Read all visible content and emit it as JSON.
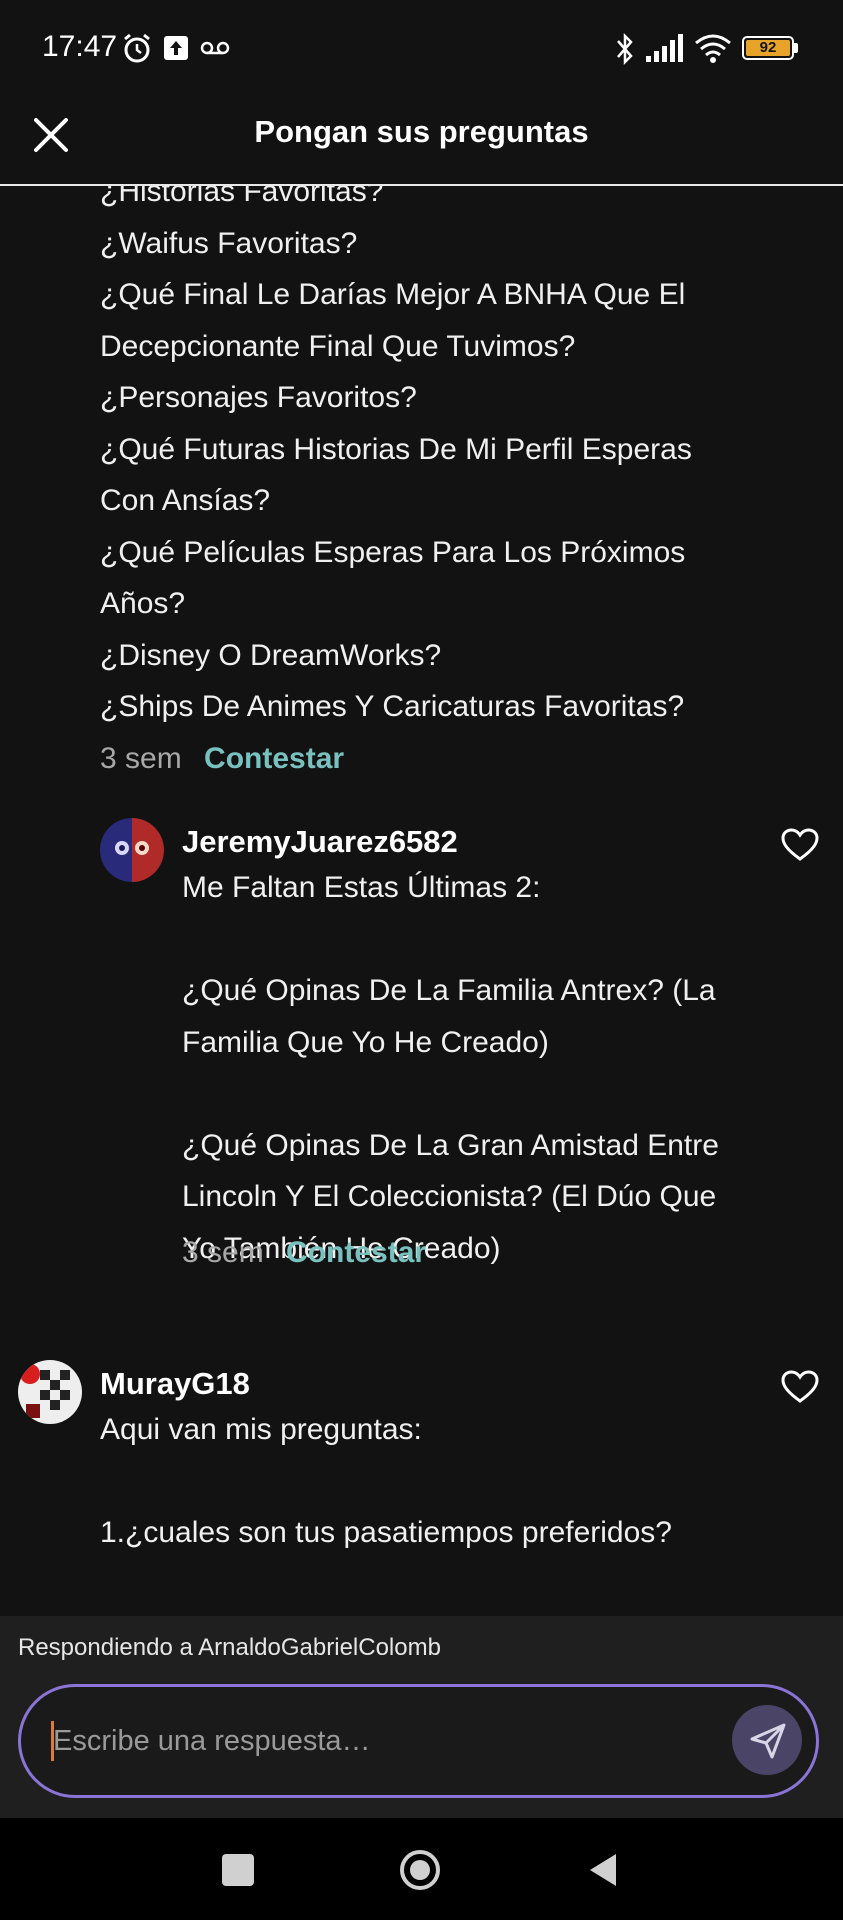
{
  "status_bar": {
    "time": "17:47",
    "battery": "92",
    "icons": [
      "alarm-icon",
      "upload-icon",
      "voicemail-icon",
      "bluetooth-icon",
      "signal-icon",
      "wifi-icon",
      "battery-icon"
    ]
  },
  "header": {
    "title": "Pongan sus preguntas"
  },
  "thread": {
    "questions": [
      "¿Historias Favoritas?",
      "¿Waifus Favoritas?",
      "¿Qué Final Le Darías Mejor A BNHA Que El",
      "Decepcionante Final Que Tuvimos?",
      "¿Personajes Favoritos?",
      "¿Qué Futuras Historias De Mi Perfil Esperas",
      "Con Ansías?",
      "¿Qué Películas Esperas Para Los Próximos",
      "Años?",
      "¿Disney O DreamWorks?",
      "¿Ships De Animes Y Caricaturas Favoritas?"
    ],
    "time": "3 sem",
    "reply_label": "Contestar"
  },
  "comments": [
    {
      "username": "JeremyJuarez6582",
      "text": "Me Faltan Estas Últimas 2:\n\n¿Qué Opinas De La Familia Antrex? (La\nFamilia Que Yo He Creado)\n\n¿Qué Opinas De La Gran Amistad Entre\nLincoln Y El Coleccionista? (El Dúo Que\nYo También He Creado)",
      "time": "3 sem",
      "reply_label": "Contestar"
    },
    {
      "username": "MurayG18",
      "text": "Aqui van mis preguntas:\n\n1.¿cuales son tus pasatiempos preferidos?"
    }
  ],
  "reply_bar": {
    "replying_to": "Respondiendo a ArnaldoGabrielColomb",
    "placeholder": "Escribe una respuesta…"
  },
  "colors": {
    "background": "#121212",
    "accent_link": "#79c1bf",
    "input_border": "#8a75d6",
    "send_button": "#4a4566",
    "battery_fill": "#e8a42a"
  }
}
